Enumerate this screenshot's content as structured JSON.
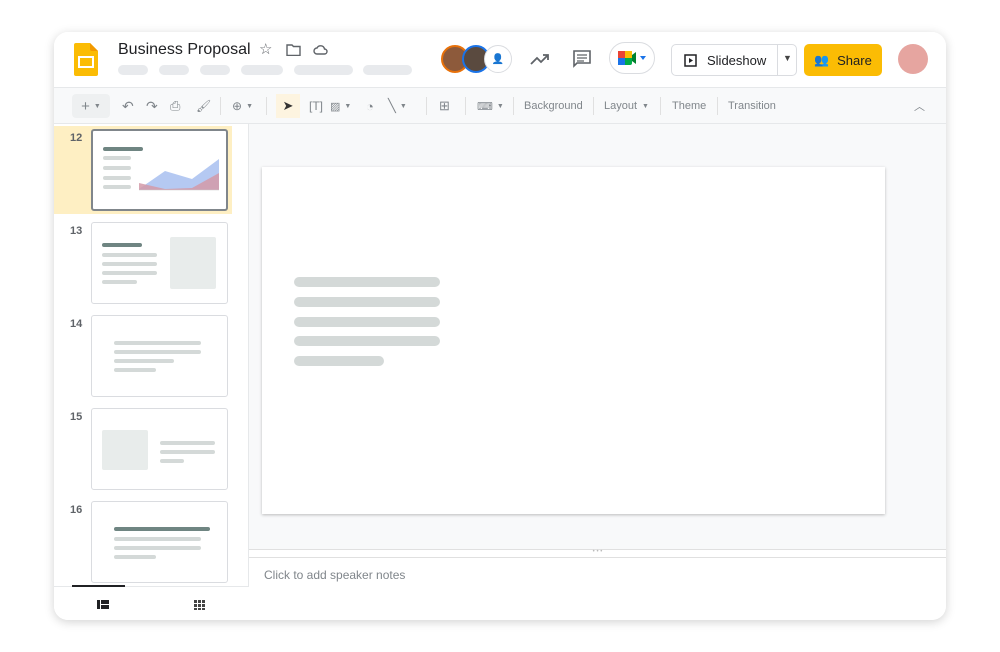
{
  "app": {
    "title": "Business Proposal",
    "menu_placeholders": 6
  },
  "header": {
    "slideshow_label": "Slideshow",
    "share_label": "Share",
    "accent": "#fbbc04"
  },
  "toolbar": {
    "background": "Background",
    "layout": "Layout",
    "theme": "Theme",
    "transition": "Transition"
  },
  "slides": [
    {
      "number": "12",
      "selected": true
    },
    {
      "number": "13"
    },
    {
      "number": "14"
    },
    {
      "number": "15"
    },
    {
      "number": "16"
    }
  ],
  "notes": {
    "placeholder": "Click to add speaker notes"
  }
}
